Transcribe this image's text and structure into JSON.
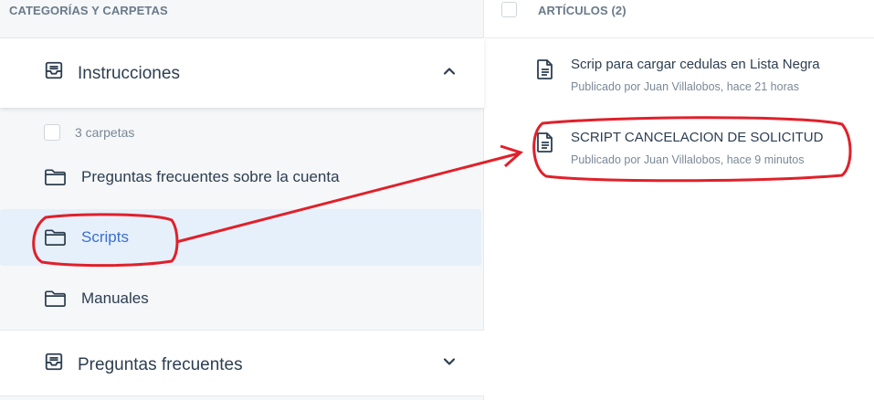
{
  "left_panel": {
    "header": "CATEGORÍAS Y CARPETAS",
    "categories": [
      {
        "label": "Instrucciones",
        "icon": "inbox-icon",
        "state": "expanded"
      },
      {
        "label": "Preguntas frecuentes",
        "icon": "inbox-icon",
        "state": "collapsed"
      }
    ],
    "folder_count": "3 carpetas",
    "folders": [
      {
        "label": "Preguntas frecuentes sobre la cuenta",
        "icon": "folder-icon"
      },
      {
        "label": "Scripts",
        "icon": "folder-icon",
        "selected": true
      },
      {
        "label": "Manuales",
        "icon": "folder-icon"
      }
    ]
  },
  "right_panel": {
    "header": "ARTÍCULOS (2)",
    "articles": [
      {
        "title": "Scrip para cargar cedulas en Lista Negra",
        "meta": "Publicado por Juan Villalobos, hace 21 horas",
        "icon": "document-icon"
      },
      {
        "title": "SCRIPT CANCELACION DE SOLICITUD",
        "meta": "Publicado por Juan Villalobos, hace 9 minutos",
        "icon": "document-icon"
      }
    ]
  },
  "colors": {
    "selected_bg": "#e6f0fb",
    "selected_text": "#3a6fcf",
    "annotation_red": "#e0202a"
  }
}
